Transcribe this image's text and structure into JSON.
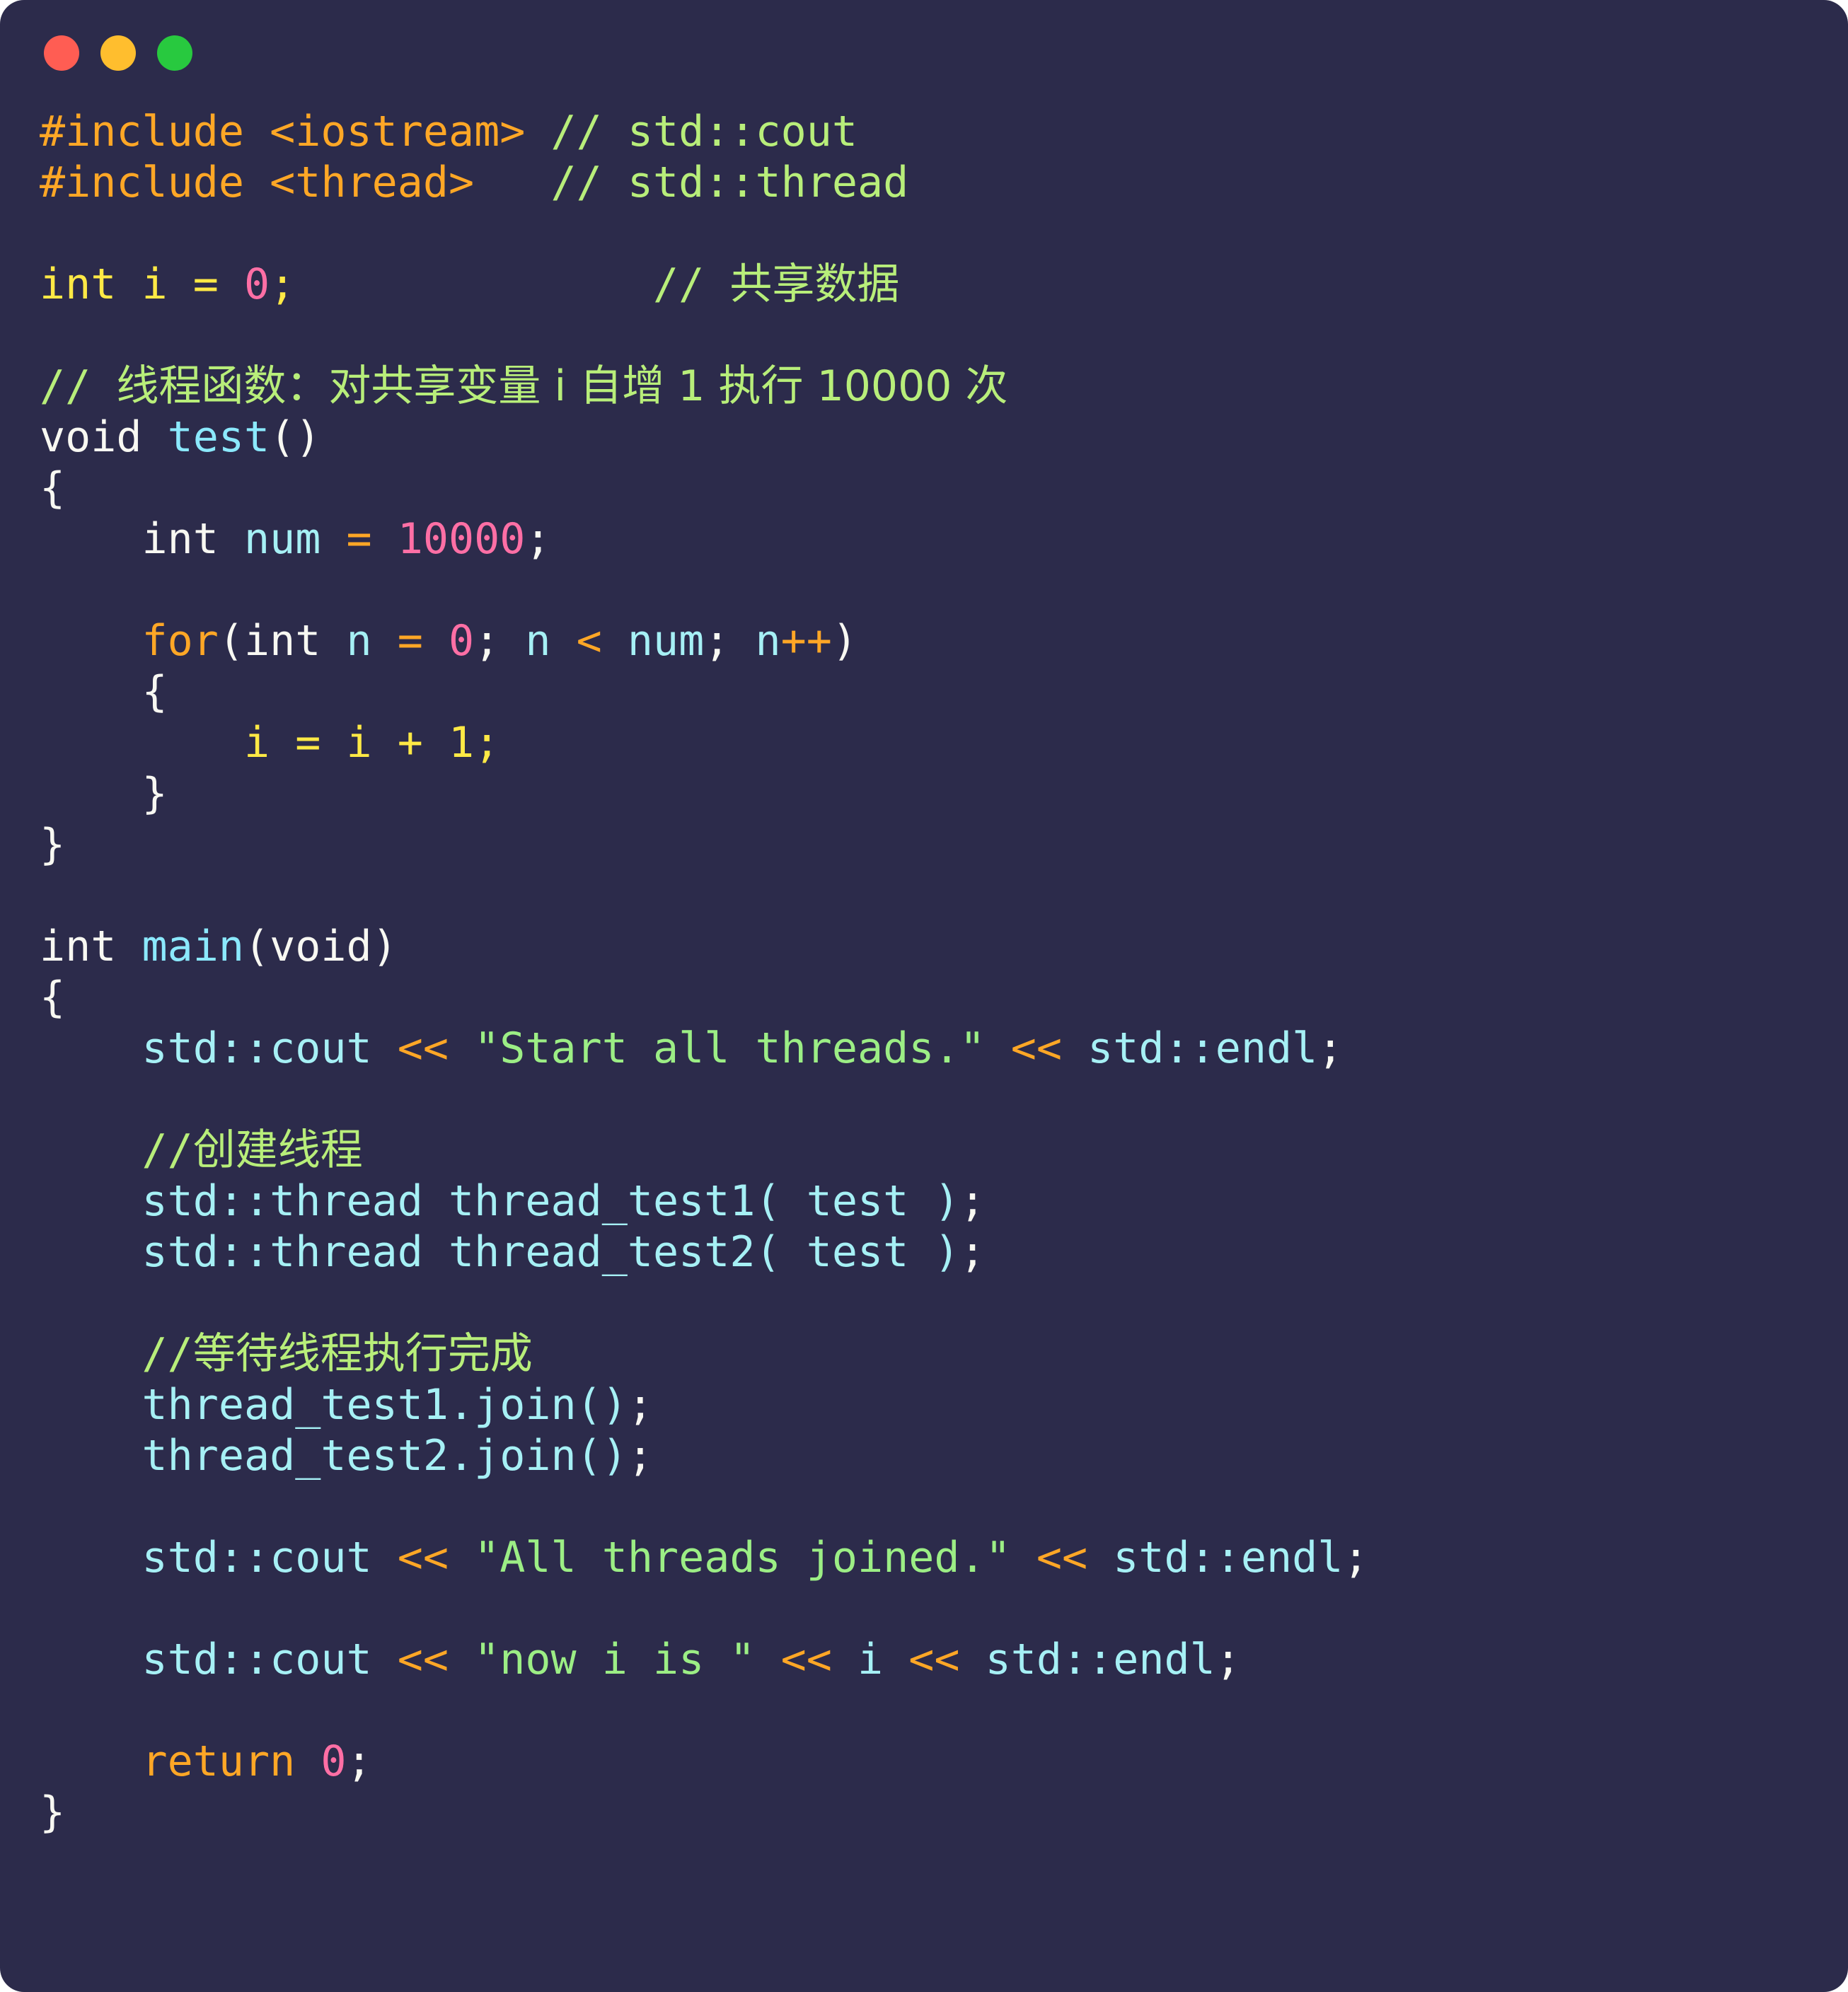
{
  "window": {
    "background_color": "#2C2B4B",
    "title": "",
    "controls": [
      {
        "name": "close",
        "color": "#FF5D53"
      },
      {
        "name": "minimize",
        "color": "#FFBE2E"
      },
      {
        "name": "maximize",
        "color": "#28C93F"
      }
    ]
  },
  "theme": {
    "plain": "#F8F8F2",
    "preprocessor": "#FFA726",
    "comment": "#B8EE7A",
    "keyword": "#FFA726",
    "function": "#8BE9FD",
    "identifier": "#A6F0F5",
    "number": "#FF6FA5",
    "string": "#9CEE85",
    "operator": "#FFA726",
    "variable": "#FFE945"
  },
  "code": {
    "language": "cpp",
    "plain_text": "#include <iostream> // std::cout\n#include <thread>   // std::thread\n\nint i = 0;              // 共享数据\n\n// 线程函数：对共享变量 i 自增 1 执行 10000 次\nvoid test()\n{\n    int num = 10000;\n\n    for(int n = 0; n < num; n++)\n    {\n        i = i + 1;\n    }\n}\n\nint main(void)\n{\n    std::cout << \"Start all threads.\" << std::endl;\n\n    //创建线程\n    std::thread thread_test1( test );\n    std::thread thread_test2( test );\n\n    //等待线程执行完成\n    thread_test1.join();\n    thread_test2.join();\n\n    std::cout << \"All threads joined.\" << std::endl;\n\n    std::cout << \"now i is \" << i << std::endl;\n\n    return 0;\n}",
    "lines": [
      {
        "tokens": [
          {
            "t": "pre",
            "v": "#include <iostream>"
          },
          {
            "t": "plain",
            "v": " "
          },
          {
            "t": "comment",
            "v": "// std::cout"
          }
        ]
      },
      {
        "tokens": [
          {
            "t": "pre",
            "v": "#include <thread>"
          },
          {
            "t": "plain",
            "v": "   "
          },
          {
            "t": "comment",
            "v": "// std::thread"
          }
        ]
      },
      {
        "tokens": []
      },
      {
        "tokens": [
          {
            "t": "var",
            "v": "int i = "
          },
          {
            "t": "num",
            "v": "0"
          },
          {
            "t": "var",
            "v": ";"
          },
          {
            "t": "plain",
            "v": "              "
          },
          {
            "t": "comment",
            "v": "// "
          },
          {
            "t": "comment-cjk",
            "v": "共享数据"
          }
        ]
      },
      {
        "tokens": []
      },
      {
        "tokens": [
          {
            "t": "comment",
            "v": "// "
          },
          {
            "t": "comment-cjk",
            "v": "线程函数：对共享变量 i 自增 1 执行 10000 次"
          }
        ]
      },
      {
        "tokens": [
          {
            "t": "type",
            "v": "void "
          },
          {
            "t": "func",
            "v": "test"
          },
          {
            "t": "punct",
            "v": "()"
          }
        ]
      },
      {
        "tokens": [
          {
            "t": "punct",
            "v": "{"
          }
        ]
      },
      {
        "tokens": [
          {
            "t": "plain",
            "v": "    "
          },
          {
            "t": "type",
            "v": "int "
          },
          {
            "t": "ident",
            "v": "num"
          },
          {
            "t": "plain",
            "v": " "
          },
          {
            "t": "op",
            "v": "="
          },
          {
            "t": "plain",
            "v": " "
          },
          {
            "t": "num",
            "v": "10000"
          },
          {
            "t": "punct",
            "v": ";"
          }
        ]
      },
      {
        "tokens": []
      },
      {
        "tokens": [
          {
            "t": "plain",
            "v": "    "
          },
          {
            "t": "keyword",
            "v": "for"
          },
          {
            "t": "punct",
            "v": "("
          },
          {
            "t": "type",
            "v": "int "
          },
          {
            "t": "ident",
            "v": "n"
          },
          {
            "t": "plain",
            "v": " "
          },
          {
            "t": "op",
            "v": "="
          },
          {
            "t": "plain",
            "v": " "
          },
          {
            "t": "num",
            "v": "0"
          },
          {
            "t": "punct",
            "v": "; "
          },
          {
            "t": "ident",
            "v": "n"
          },
          {
            "t": "plain",
            "v": " "
          },
          {
            "t": "op",
            "v": "<"
          },
          {
            "t": "plain",
            "v": " "
          },
          {
            "t": "ident",
            "v": "num"
          },
          {
            "t": "punct",
            "v": "; "
          },
          {
            "t": "ident",
            "v": "n"
          },
          {
            "t": "op",
            "v": "++"
          },
          {
            "t": "punct",
            "v": ")"
          }
        ]
      },
      {
        "tokens": [
          {
            "t": "plain",
            "v": "    "
          },
          {
            "t": "punct",
            "v": "{"
          }
        ]
      },
      {
        "tokens": [
          {
            "t": "plain",
            "v": "        "
          },
          {
            "t": "var",
            "v": "i = i + "
          },
          {
            "t": "var",
            "v": "1"
          },
          {
            "t": "var",
            "v": ";"
          }
        ]
      },
      {
        "tokens": [
          {
            "t": "plain",
            "v": "    "
          },
          {
            "t": "punct",
            "v": "}"
          }
        ]
      },
      {
        "tokens": [
          {
            "t": "punct",
            "v": "}"
          }
        ]
      },
      {
        "tokens": []
      },
      {
        "tokens": [
          {
            "t": "type",
            "v": "int "
          },
          {
            "t": "func",
            "v": "main"
          },
          {
            "t": "punct",
            "v": "("
          },
          {
            "t": "type",
            "v": "void"
          },
          {
            "t": "punct",
            "v": ")"
          }
        ]
      },
      {
        "tokens": [
          {
            "t": "punct",
            "v": "{"
          }
        ]
      },
      {
        "tokens": [
          {
            "t": "plain",
            "v": "    "
          },
          {
            "t": "ident",
            "v": "std::cout"
          },
          {
            "t": "plain",
            "v": " "
          },
          {
            "t": "op",
            "v": "<<"
          },
          {
            "t": "plain",
            "v": " "
          },
          {
            "t": "string",
            "v": "\"Start all threads.\""
          },
          {
            "t": "plain",
            "v": " "
          },
          {
            "t": "op",
            "v": "<<"
          },
          {
            "t": "plain",
            "v": " "
          },
          {
            "t": "ident",
            "v": "std::endl"
          },
          {
            "t": "punct",
            "v": ";"
          }
        ]
      },
      {
        "tokens": []
      },
      {
        "tokens": [
          {
            "t": "plain",
            "v": "    "
          },
          {
            "t": "comment",
            "v": "//"
          },
          {
            "t": "comment-cjk",
            "v": "创建线程"
          }
        ]
      },
      {
        "tokens": [
          {
            "t": "plain",
            "v": "    "
          },
          {
            "t": "ident",
            "v": "std::thread thread_test1( test )"
          },
          {
            "t": "punct",
            "v": ";"
          }
        ]
      },
      {
        "tokens": [
          {
            "t": "plain",
            "v": "    "
          },
          {
            "t": "ident",
            "v": "std::thread thread_test2( test )"
          },
          {
            "t": "punct",
            "v": ";"
          }
        ]
      },
      {
        "tokens": []
      },
      {
        "tokens": [
          {
            "t": "plain",
            "v": "    "
          },
          {
            "t": "comment",
            "v": "//"
          },
          {
            "t": "comment-cjk",
            "v": "等待线程执行完成"
          }
        ]
      },
      {
        "tokens": [
          {
            "t": "plain",
            "v": "    "
          },
          {
            "t": "ident",
            "v": "thread_test1.join()"
          },
          {
            "t": "punct",
            "v": ";"
          }
        ]
      },
      {
        "tokens": [
          {
            "t": "plain",
            "v": "    "
          },
          {
            "t": "ident",
            "v": "thread_test2.join()"
          },
          {
            "t": "punct",
            "v": ";"
          }
        ]
      },
      {
        "tokens": []
      },
      {
        "tokens": [
          {
            "t": "plain",
            "v": "    "
          },
          {
            "t": "ident",
            "v": "std::cout"
          },
          {
            "t": "plain",
            "v": " "
          },
          {
            "t": "op",
            "v": "<<"
          },
          {
            "t": "plain",
            "v": " "
          },
          {
            "t": "string",
            "v": "\"All threads joined.\""
          },
          {
            "t": "plain",
            "v": " "
          },
          {
            "t": "op",
            "v": "<<"
          },
          {
            "t": "plain",
            "v": " "
          },
          {
            "t": "ident",
            "v": "std::endl"
          },
          {
            "t": "punct",
            "v": ";"
          }
        ]
      },
      {
        "tokens": []
      },
      {
        "tokens": [
          {
            "t": "plain",
            "v": "    "
          },
          {
            "t": "ident",
            "v": "std::cout"
          },
          {
            "t": "plain",
            "v": " "
          },
          {
            "t": "op",
            "v": "<<"
          },
          {
            "t": "plain",
            "v": " "
          },
          {
            "t": "string",
            "v": "\"now i is \""
          },
          {
            "t": "plain",
            "v": " "
          },
          {
            "t": "op",
            "v": "<<"
          },
          {
            "t": "plain",
            "v": " "
          },
          {
            "t": "ident",
            "v": "i"
          },
          {
            "t": "plain",
            "v": " "
          },
          {
            "t": "op",
            "v": "<<"
          },
          {
            "t": "plain",
            "v": " "
          },
          {
            "t": "ident",
            "v": "std::endl"
          },
          {
            "t": "punct",
            "v": ";"
          }
        ]
      },
      {
        "tokens": []
      },
      {
        "tokens": [
          {
            "t": "plain",
            "v": "    "
          },
          {
            "t": "keyword",
            "v": "return"
          },
          {
            "t": "plain",
            "v": " "
          },
          {
            "t": "num",
            "v": "0"
          },
          {
            "t": "punct",
            "v": ";"
          }
        ]
      },
      {
        "tokens": [
          {
            "t": "punct",
            "v": "}"
          }
        ]
      }
    ]
  }
}
